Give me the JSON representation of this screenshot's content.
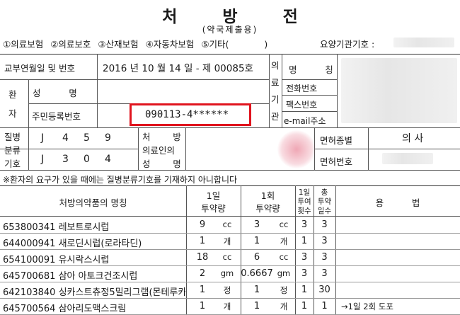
{
  "header": {
    "title": "처 방 전",
    "subtitle": "(약국제출용)"
  },
  "insurance": {
    "items": [
      "①의료보험",
      "②의료보호",
      "③산재보험",
      "④자동차보험",
      "⑤기타(",
      ")"
    ],
    "provider_code_label": "요양기관기호 :"
  },
  "issue": {
    "label": "교부연월일 및 번호",
    "value": "2016 년 10 월 14 일 - 제 00085호"
  },
  "patient": {
    "section_label": [
      "환",
      "자"
    ],
    "name_label": "성          명",
    "id_label": "주민등록번호",
    "id_value": "090113-4******"
  },
  "institution": {
    "section_label": [
      "의",
      "료",
      "기",
      "관"
    ],
    "name_label": "명          칭",
    "phone_label": "전화번호",
    "fax_label": "팩스번호",
    "email_label": "e-mail주소"
  },
  "disease": {
    "label": [
      "질병",
      "분류",
      "기호"
    ],
    "code1": [
      "J",
      "4",
      "5",
      "9"
    ],
    "code2": [
      "J",
      "3",
      "0",
      "4"
    ]
  },
  "prescriber": {
    "label": [
      "처        방",
      "의료인의",
      "성        명"
    ],
    "license_type_label": "면허종별",
    "license_type_value": "의 사",
    "license_no_label": "면허번호"
  },
  "notice": "※환자의 요구가 있을 때에는 질병분류기호를 기재하지 아니합니다",
  "rx_table": {
    "headers": {
      "drug": "처방의약품의 명칭",
      "daily_dose": [
        "1일",
        "투약량"
      ],
      "single_dose": [
        "1회",
        "투약량"
      ],
      "times": [
        "1일",
        "투여",
        "횟수"
      ],
      "days": [
        "총",
        "투약",
        "일수"
      ],
      "usage": "용          법"
    },
    "rows": [
      {
        "name": "653800341 레보트로시럽",
        "d1": "9",
        "u1": "cc",
        "d2": "3",
        "u2": "cc",
        "times": "3",
        "days": "3",
        "usage": ""
      },
      {
        "name": "644000941 새로딘시럽(로라타딘)",
        "d1": "1",
        "u1": "개",
        "d2": "1",
        "u2": "개",
        "times": "1",
        "days": "3",
        "usage": ""
      },
      {
        "name": "654100091 유시락스시럽",
        "d1": "18",
        "u1": "cc",
        "d2": "6",
        "u2": "cc",
        "times": "3",
        "days": "3",
        "usage": ""
      },
      {
        "name": "645700681 삼아 아토크건조시럽",
        "d1": "2",
        "u1": "gm",
        "d2": "0.6667",
        "u2": "gm",
        "times": "3",
        "days": "3",
        "usage": ""
      },
      {
        "name": "642103840 싱카스트츄정5밀리그램(몬테루카",
        "d1": "1",
        "u1": "정",
        "d2": "1",
        "u2": "정",
        "times": "1",
        "days": "30",
        "usage": ""
      },
      {
        "name": "645700564 삼아리도맥스크림",
        "d1": "1",
        "u1": "개",
        "d2": "1",
        "u2": "개",
        "times": "1",
        "days": "1",
        "usage": "→1일 2회 도포"
      }
    ]
  }
}
